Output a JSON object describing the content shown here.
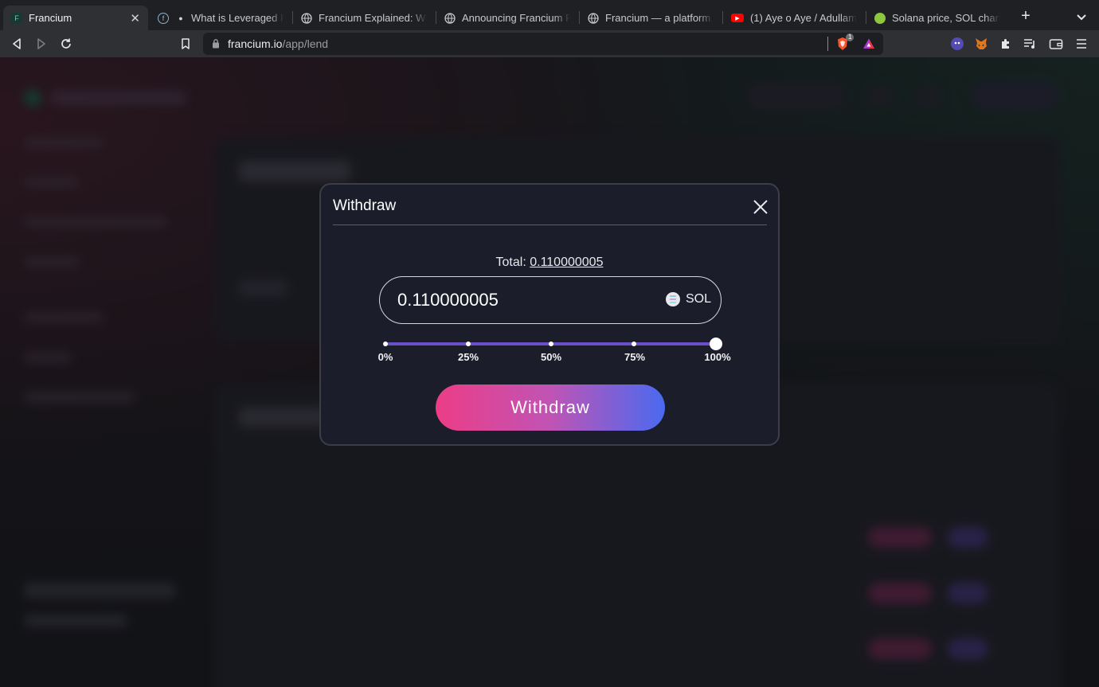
{
  "browser": {
    "tabs": [
      {
        "label": "Francium",
        "icon": "francium-icon",
        "active": true
      },
      {
        "label": "What is Leveraged Farm",
        "icon": "bulb-icon"
      },
      {
        "label": "Francium Explained: What",
        "icon": "globe-icon"
      },
      {
        "label": "Announcing Francium Prot",
        "icon": "globe-icon"
      },
      {
        "label": "Francium — a platform pro",
        "icon": "globe-icon"
      },
      {
        "label": "(1) Aye o Aye / Adullam - Y",
        "icon": "youtube-icon"
      },
      {
        "label": "Solana price, SOL chart, ar",
        "icon": "coingecko-icon"
      }
    ],
    "address": {
      "host": "francium.io",
      "path": "/app/lend"
    },
    "shield_count": "1"
  },
  "modal": {
    "title": "Withdraw",
    "total_label": "Total:",
    "total_value": "0.110000005",
    "amount_value": "0.110000005",
    "token_symbol": "SOL",
    "slider": {
      "value_percent": 100,
      "marks": [
        "0%",
        "25%",
        "50%",
        "75%",
        "100%"
      ]
    },
    "submit_label": "Withdraw"
  },
  "colors": {
    "modal_bg": "#1b1d2b",
    "slider_track": "#6a4fc6",
    "button_gradient_start": "#ec3d86",
    "button_gradient_end": "#4a6af0"
  }
}
